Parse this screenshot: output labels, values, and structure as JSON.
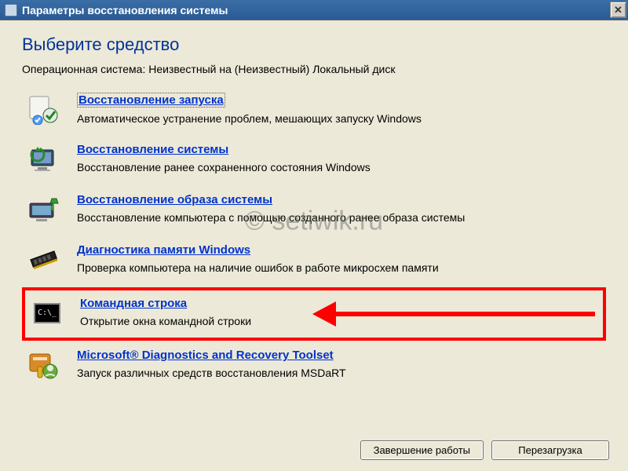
{
  "titlebar": {
    "title": "Параметры восстановления системы",
    "close": "✕"
  },
  "heading": "Выберите средство",
  "os_line": "Операционная система: Неизвестный на (Неизвестный) Локальный диск",
  "tools": [
    {
      "link": "Восстановление запуска",
      "desc": "Автоматическое устранение проблем, мешающих запуску Windows"
    },
    {
      "link": "Восстановление системы",
      "desc": "Восстановление ранее сохраненного состояния Windows"
    },
    {
      "link": "Восстановление образа системы",
      "desc": "Восстановление компьютера с помощью  созданного ранее образа системы"
    },
    {
      "link": "Диагностика памяти Windows",
      "desc": "Проверка компьютера на наличие ошибок в работе микросхем памяти"
    },
    {
      "link": "Командная строка",
      "desc": "Открытие окна командной строки"
    },
    {
      "link": "Microsoft® Diagnostics and Recovery Toolset",
      "desc": "Запуск различных средств восстановления MSDaRT"
    }
  ],
  "buttons": {
    "shutdown": "Завершение работы",
    "restart": "Перезагрузка"
  },
  "watermark": "© setiwik.ru"
}
